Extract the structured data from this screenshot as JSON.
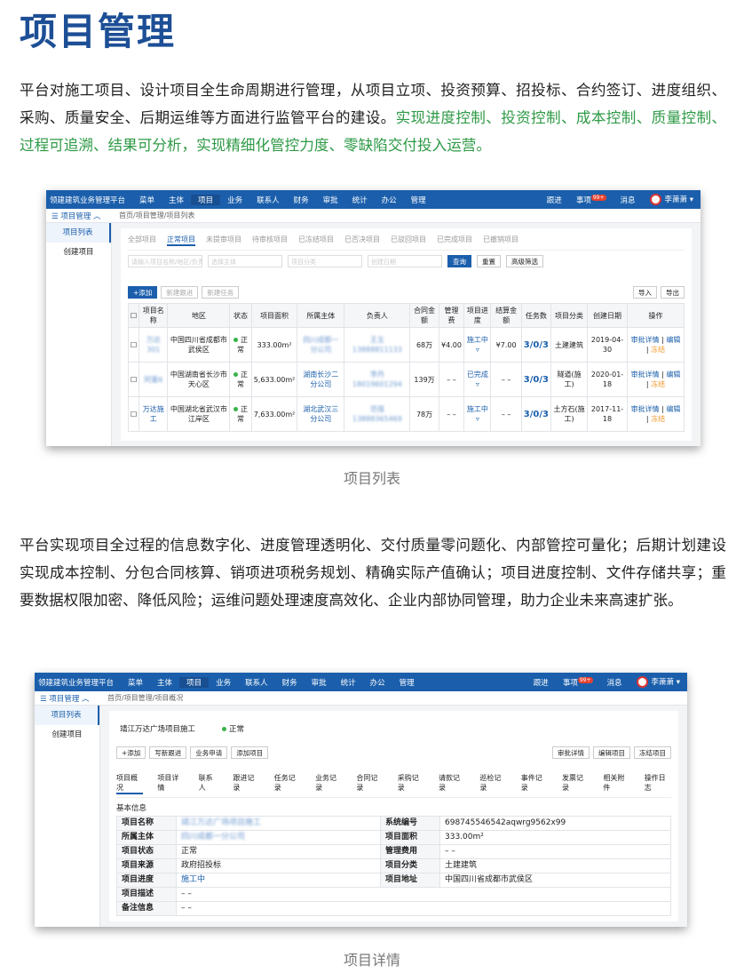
{
  "title": "项目管理",
  "para1": {
    "plain": "平台对施工项目、设计项目全生命周期进行管理，从项目立项、投资预算、招投标、合约签订、进度组织、采购、质量安全、后期运维等方面进行监管平台的建设。",
    "highlight": "实现进度控制、投资控制、成本控制、质量控制、过程可追溯、结果可分析，实现精细化管控力度、零缺陷交付投入运营。"
  },
  "para2": "平台实现项目全过程的信息数字化、进度管理透明化、交付质量零问题化、内部管控可量化；后期计划建设实现成本控制、分包合同核算、销项进项税务规划、精确实际产值确认；项目进度控制、文件存储共享；重要数据权限加密、降低风险；运维问题处理速度高效化、企业内部协同管理，助力企业未来高速扩张。",
  "caption1": "项目列表",
  "caption2": "项目详情",
  "app": {
    "brand": "领建建筑业务管理平台",
    "menu": [
      "菜单",
      "主体",
      "项目",
      "业务",
      "联系人",
      "财务",
      "审批",
      "统计",
      "办公",
      "管理"
    ],
    "right": {
      "track": "跟进",
      "todo": "事项",
      "badge": "99+",
      "msg": "消息",
      "user": "李萧萧"
    },
    "module": "项目管理",
    "side": [
      "项目列表",
      "创建项目"
    ]
  },
  "list": {
    "breadcrumb": "首页/项目管理/项目列表",
    "tabs": [
      "全部项目",
      "正常项目",
      "未提审项目",
      "待审核项目",
      "已冻结项目",
      "已否决项目",
      "已驳回项目",
      "已完成项目",
      "已撤销项目"
    ],
    "filters": {
      "search": "请输入项目名称/地区/负责人",
      "owner": "选择主体",
      "cat": "项目分类",
      "date": "创建日期",
      "query": "查询",
      "reset": "重置",
      "adv": "高级筛选"
    },
    "actions": {
      "add": "+添加",
      "follow": "新建跟进",
      "task": "新建任务",
      "import": "导入",
      "export": "导出"
    },
    "headers": [
      "",
      "项目名称",
      "地区",
      "状态",
      "项目面积",
      "所属主体",
      "负责人",
      "合同金额",
      "管理费",
      "项目进度",
      "结算金额",
      "任务数",
      "项目分类",
      "创建日期",
      "操作"
    ],
    "rows": [
      {
        "name": "万达301",
        "region": "中国四川省成都市武侯区",
        "status": "正常",
        "area": "333.00m²",
        "owner": "四川成都一分公司",
        "person": "王五 13888811133",
        "amount": "68万",
        "fee": "¥4.00",
        "progress": "施工中",
        "settle": "¥7.00",
        "tasks": "3/0/3",
        "cat": "土建建筑",
        "date": "2019-04-30"
      },
      {
        "name": "阿董6",
        "region": "中国湖南省长沙市天心区",
        "status": "正常",
        "area": "5,633.00m²",
        "owner": "湖南长沙二分公司",
        "person": "李丹 18019601294",
        "amount": "139万",
        "fee": "– –",
        "progress": "已完成",
        "settle": "– –",
        "tasks": "3/0/3",
        "cat": "隧道(施工)",
        "date": "2020-01-18"
      },
      {
        "name": "万达施工",
        "region": "中国湖北省武汉市江岸区",
        "status": "正常",
        "area": "7,633.00m²",
        "owner": "湖北武汉三分公司",
        "person": "范强 13888365469",
        "amount": "78万",
        "fee": "– –",
        "progress": "施工中",
        "settle": "– –",
        "tasks": "3/0/3",
        "cat": "土方石(施工)",
        "date": "2017-11-18"
      }
    ],
    "ops": {
      "detail": "审批详情",
      "edit": "编辑",
      "freeze": "冻结"
    }
  },
  "detail": {
    "breadcrumb": "首页/项目管理/项目概况",
    "project": "靖江万达广场项目施工",
    "status": "正常",
    "actions": [
      "+添加",
      "写新跟进",
      "业务申请",
      "添加项目"
    ],
    "right_actions": [
      "审批详情",
      "编辑项目",
      "冻结项目"
    ],
    "tabs": [
      "项目概况",
      "项目详情",
      "联系人",
      "跟进记录",
      "任务记录",
      "业务记录",
      "合同记录",
      "采购记录",
      "请款记录",
      "巡检记录",
      "事件记录",
      "发票记录",
      "相关附件",
      "操作日志"
    ],
    "section": "基本信息",
    "fields": {
      "name_k": "项目名称",
      "name_v": "靖江万达广场项目施工",
      "code_k": "系统编号",
      "code_v": "698745546542aqwrg9562x99",
      "owner_k": "所属主体",
      "owner_v": "四川成都一分公司",
      "area_k": "项目面积",
      "area_v": "333.00m²",
      "state_k": "项目状态",
      "state_v": "正常",
      "fee_k": "管理费用",
      "fee_v": "– –",
      "src_k": "项目来源",
      "src_v": "政府招投标",
      "cat_k": "项目分类",
      "cat_v": "土建建筑",
      "prog_k": "项目进度",
      "prog_v": "施工中",
      "addr_k": "项目地址",
      "addr_v": "中国四川省成都市武侯区",
      "desc_k": "项目描述",
      "desc_v": "– –",
      "note_k": "备注信息",
      "note_v": "– –"
    }
  }
}
